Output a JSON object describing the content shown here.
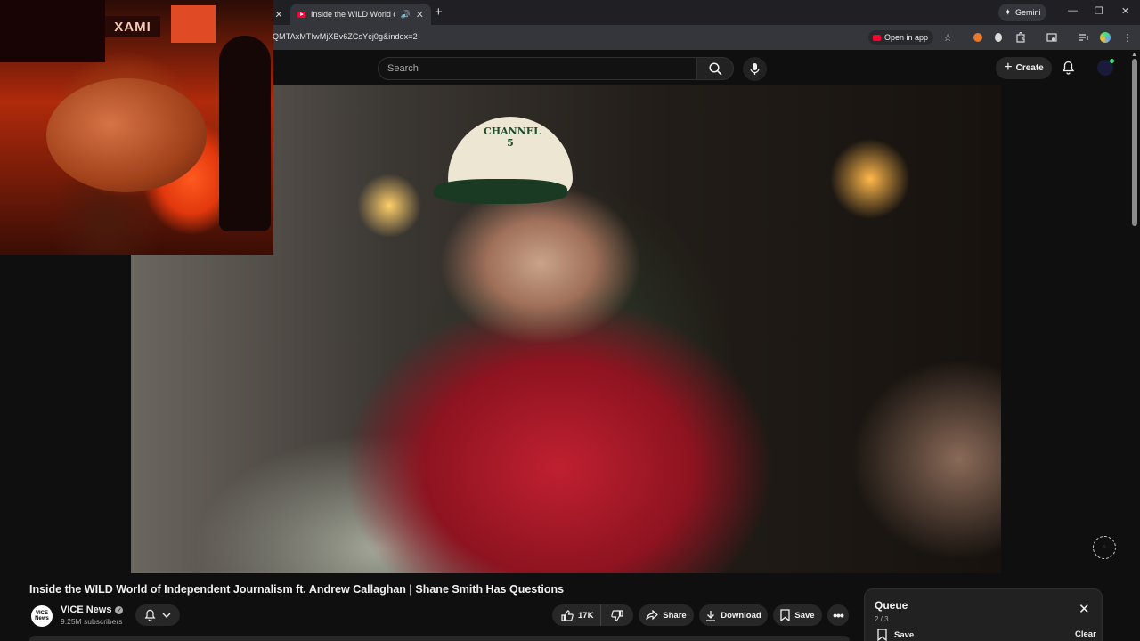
{
  "browser": {
    "active_tab_title": "Inside the WILD World of In",
    "speaker_glyph": "🔊",
    "new_tab_glyph": "+",
    "close_glyph": "✕",
    "gemini_label": "Gemini",
    "url": "QMTAxMTIwMjXBv6ZCsYcj0g&index=2",
    "open_in_app_label": "Open in app",
    "window_controls": {
      "minimize": "—",
      "restore": "❐",
      "close": "✕"
    }
  },
  "youtube": {
    "search_placeholder": "Search",
    "create_label": "Create"
  },
  "webcam": {
    "sign_text": "XAMI"
  },
  "video": {
    "cap_logo_text": "CHANNEL 5"
  },
  "watch": {
    "title": "Inside the WILD World of Independent Journalism ft. Andrew Callaghan | Shane Smith Has Questions",
    "channel": {
      "logo_text": "VICE News",
      "name": "VICE News",
      "subscribers": "9.25M subscribers"
    },
    "actions": {
      "likes": "17K",
      "share": "Share",
      "download": "Download",
      "save": "Save"
    }
  },
  "queue": {
    "title": "Queue",
    "count": "2 / 3",
    "save_label": "Save",
    "clear_label": "Clear"
  },
  "colors": {
    "youtube_red": "#ff0033",
    "page_background": "#0f0f0f",
    "pill_background": "#272727"
  },
  "icons": [
    "search-icon",
    "mic-icon",
    "bell-icon",
    "like-icon",
    "dislike-icon",
    "share-icon",
    "download-icon",
    "save-icon",
    "more-icon",
    "close-icon",
    "star-icon",
    "extensions-icon"
  ]
}
